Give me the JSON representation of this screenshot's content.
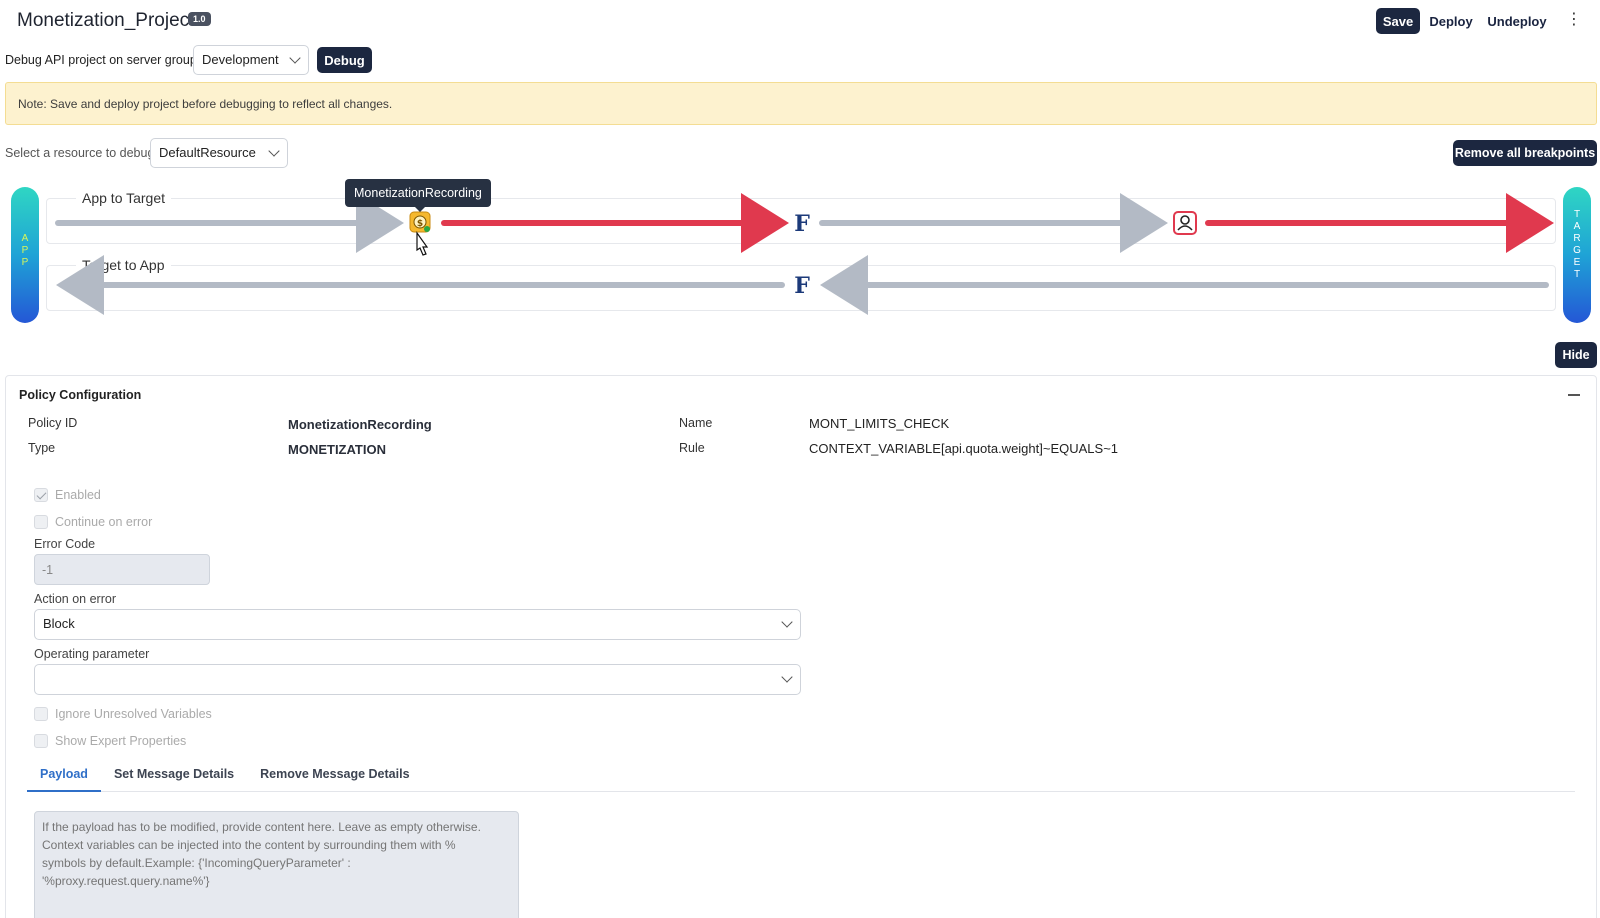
{
  "header": {
    "title": "Monetization_Project",
    "version": "1.0",
    "save_label": "Save",
    "deploy_label": "Deploy",
    "undeploy_label": "Undeploy",
    "more_glyph": "⋮"
  },
  "debug_bar": {
    "label": "Debug API project on server group",
    "server_group": "Development",
    "debug_label": "Debug"
  },
  "note": "Note: Save and deploy project before debugging to reflect all changes.",
  "resource_bar": {
    "label": "Select a resource to debug",
    "resource": "DefaultResource",
    "remove_breakpoints_label": "Remove all breakpoints"
  },
  "flow": {
    "app_letters": "A\nP\nP",
    "target_letters": "T\nA\nR\nG\nE\nT",
    "request_label": "App to Target",
    "response_label": "Target to App",
    "tooltip": "MonetizationRecording",
    "flow_glyph": "F",
    "colors": {
      "normal": "#b3bac5",
      "breakpoint": "#e0394e",
      "policy_icon": "#f5b82e",
      "fx": "#1c3a7a"
    }
  },
  "hide_label": "Hide",
  "policy": {
    "section_title": "Policy Configuration",
    "policy_id_key": "Policy ID",
    "policy_id": "MonetizationRecording",
    "type_key": "Type",
    "type": "MONETIZATION",
    "name_key": "Name",
    "name": "MONT_LIMITS_CHECK",
    "rule_key": "Rule",
    "rule": "CONTEXT_VARIABLE[api.quota.weight]~EQUALS~1",
    "enabled_label": "Enabled",
    "continue_on_error_label": "Continue on error",
    "error_code_label": "Error Code",
    "error_code": "-1",
    "action_on_error_label": "Action on error",
    "action_on_error": "Block",
    "operating_parameter_label": "Operating parameter",
    "operating_parameter": "",
    "ignore_unresolved_label": "Ignore Unresolved Variables",
    "show_expert_label": "Show Expert Properties",
    "tabs": [
      "Payload",
      "Set Message Details",
      "Remove Message Details"
    ],
    "payload_placeholder": "If the payload has to be modified, provide content here. Leave as empty otherwise.\nContext variables can be injected into the content by surrounding them with %\nsymbols by default.Example: {'IncomingQueryParameter' :\n'%proxy.request.query.name%'}"
  }
}
